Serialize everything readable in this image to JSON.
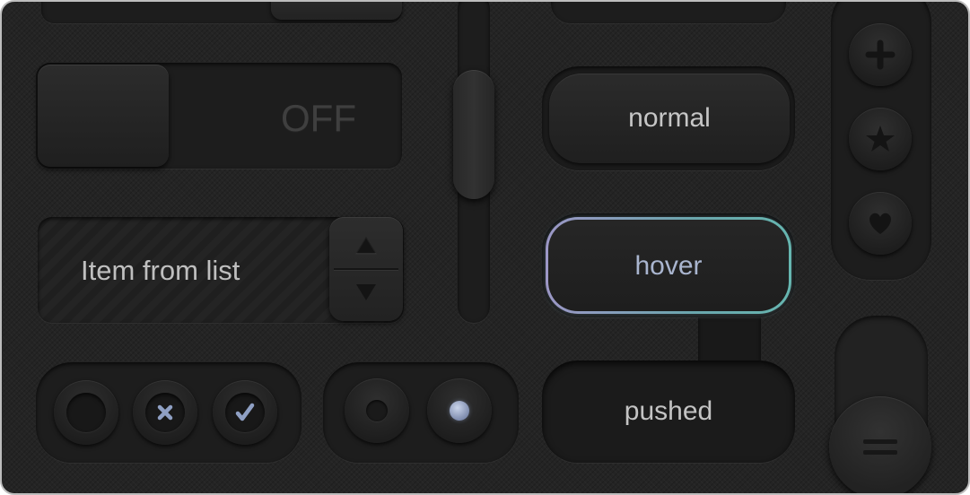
{
  "toggle": {
    "state_label": "OFF"
  },
  "list": {
    "selected_item": "Item from list"
  },
  "buttons": {
    "normal_label": "normal",
    "hover_label": "hover",
    "pushed_label": "pushed"
  },
  "checkboxes": {
    "states": [
      "empty",
      "cross",
      "check"
    ]
  },
  "radios": {
    "states": [
      "off",
      "on"
    ]
  },
  "icon_buttons": [
    "plus-icon",
    "star-icon",
    "heart-icon"
  ],
  "colors": {
    "background": "#242424",
    "text": "#c6c6c6",
    "hover_text": "#a9b5cf",
    "hover_border_start": "#9c97c6",
    "hover_border_end": "#66b6b0",
    "radio_selected": "#7e8cae",
    "checkbox_mark": "#8fa0c4"
  }
}
